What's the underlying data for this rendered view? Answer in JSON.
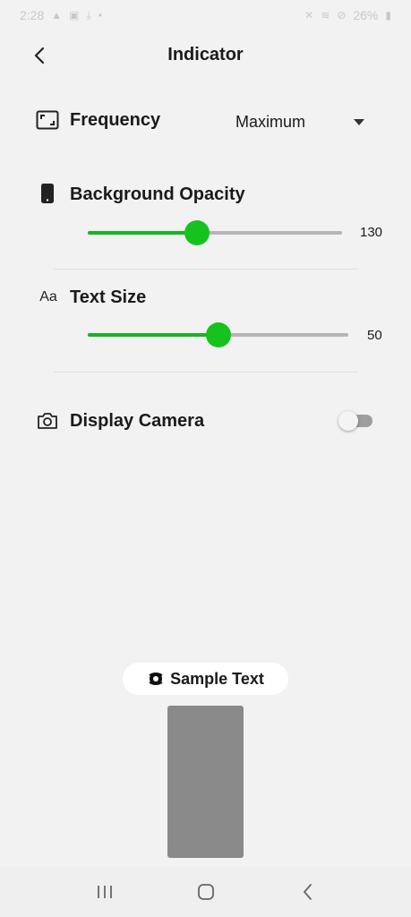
{
  "status_bar": {
    "time": "2:28",
    "battery": "26%"
  },
  "header": {
    "title": "Indicator"
  },
  "frequency": {
    "label": "Frequency",
    "value": "Maximum"
  },
  "background_opacity": {
    "label": "Background Opacity",
    "value": "130",
    "level": 0.43
  },
  "text_size": {
    "label": "Text Size",
    "value": "50",
    "level": 0.5,
    "icon_text": "Aa"
  },
  "display_camera": {
    "label": "Display Camera",
    "enabled": false
  },
  "preview": {
    "sample_text": "Sample Text"
  },
  "colors": {
    "accent": "#16c21e",
    "track": "#b5b5b5",
    "background": "#f2f2f2",
    "preview_box": "#8a8a8a"
  }
}
